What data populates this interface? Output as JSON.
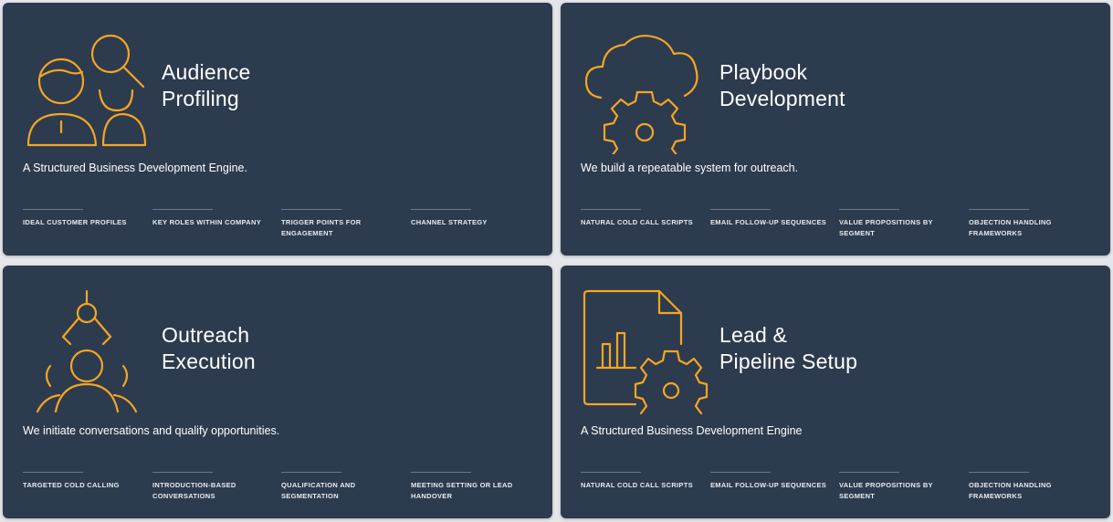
{
  "colors": {
    "card_bg": "#2d3b4f",
    "accent": "#f5a623",
    "page_bg": "#e4e6e9"
  },
  "cards": [
    {
      "icon": "audience-profiling-icon",
      "title_line1": "Audience",
      "title_line2": "Profiling",
      "description": "A Structured Business Development Engine.",
      "features": [
        "IDEAL CUSTOMER PROFILES",
        "KEY ROLES WITHIN COMPANY",
        "TRIGGER POINTS FOR ENGAGEMENT",
        "CHANNEL STRATEGY"
      ]
    },
    {
      "icon": "cloud-gear-icon",
      "title_line1": "Playbook",
      "title_line2": "Development",
      "description": "We build a repeatable system for outreach.",
      "features": [
        "NATURAL COLD CALL SCRIPTS",
        "EMAIL FOLLOW-UP SEQUENCES",
        "VALUE PROPOSITIONS BY SEGMENT",
        "OBJECTION HANDLING FRAMEWORKS"
      ]
    },
    {
      "icon": "outreach-people-icon",
      "title_line1": "Outreach",
      "title_line2": "Execution",
      "description": "We initiate conversations and qualify opportunities.",
      "features": [
        "TARGETED COLD CALLING",
        "INTRODUCTION-BASED CONVERSATIONS",
        "QUALIFICATION AND SEGMENTATION",
        "MEETING SETTING OR LEAD HANDOVER"
      ]
    },
    {
      "icon": "document-chart-gear-icon",
      "title_line1": "Lead &",
      "title_line2": "Pipeline Setup",
      "description": "A Structured Business Development Engine",
      "features": [
        "NATURAL COLD CALL SCRIPTS",
        "EMAIL FOLLOW-UP SEQUENCES",
        "VALUE PROPOSITIONS BY SEGMENT",
        "OBJECTION HANDLING FRAMEWORKS"
      ]
    }
  ]
}
